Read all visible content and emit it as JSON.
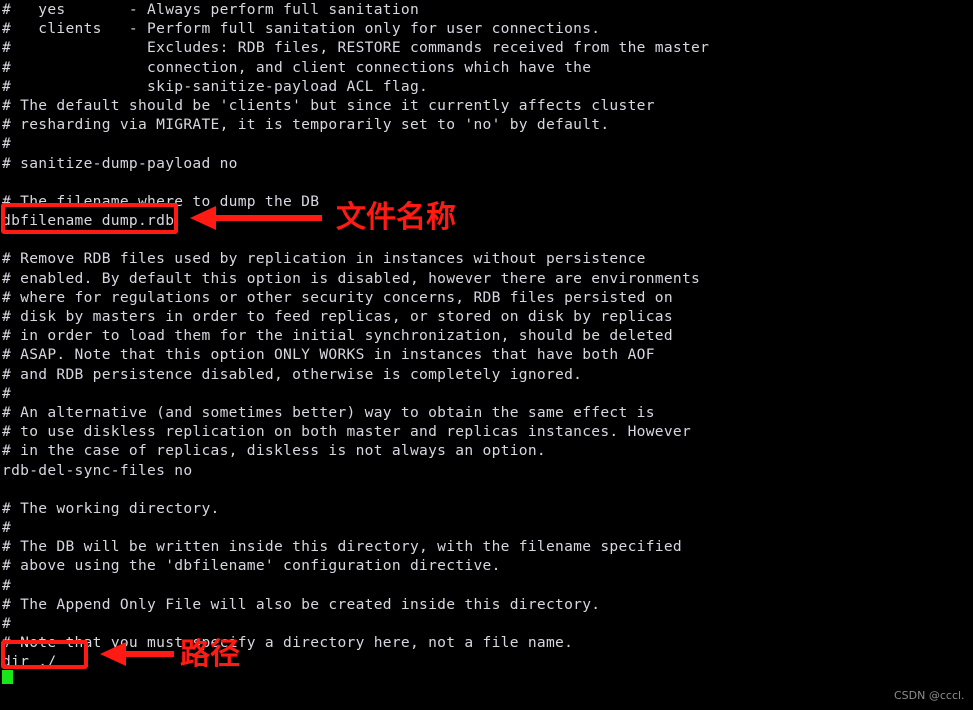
{
  "terminal": {
    "background_color": "#000000",
    "text_color": "#d7d7e0",
    "cursor_color": "#19e619",
    "accent_color": "#ff1a13",
    "lines": [
      "#   yes       - Always perform full sanitation",
      "#   clients   - Perform full sanitation only for user connections.",
      "#               Excludes: RDB files, RESTORE commands received from the master",
      "#               connection, and client connections which have the",
      "#               skip-sanitize-payload ACL flag.",
      "# The default should be 'clients' but since it currently affects cluster",
      "# resharding via MIGRATE, it is temporarily set to 'no' by default.",
      "#",
      "# sanitize-dump-payload no",
      "",
      "# The filename where to dump the DB",
      "dbfilename dump.rdb",
      "",
      "# Remove RDB files used by replication in instances without persistence",
      "# enabled. By default this option is disabled, however there are environments",
      "# where for regulations or other security concerns, RDB files persisted on",
      "# disk by masters in order to feed replicas, or stored on disk by replicas",
      "# in order to load them for the initial synchronization, should be deleted",
      "# ASAP. Note that this option ONLY WORKS in instances that have both AOF",
      "# and RDB persistence disabled, otherwise is completely ignored.",
      "#",
      "# An alternative (and sometimes better) way to obtain the same effect is",
      "# to use diskless replication on both master and replicas instances. However",
      "# in the case of replicas, diskless is not always an option.",
      "rdb-del-sync-files no",
      "",
      "# The working directory.",
      "#",
      "# The DB will be written inside this directory, with the filename specified",
      "# above using the 'dbfilename' configuration directive.",
      "#",
      "# The Append Only File will also be created inside this directory.",
      "#",
      "# Note that you must specify a directory here, not a file name.",
      "dir ./",
      ""
    ]
  },
  "annotations": [
    {
      "id": "dbfilename",
      "highlight_text": "dbfilename dump.rdb",
      "label": "文件名称",
      "color": "#ff1a13"
    },
    {
      "id": "dir",
      "highlight_text": "dir ./",
      "label": "路径",
      "color": "#ff1a13"
    }
  ],
  "watermark": {
    "text": "CSDN @cccl."
  }
}
